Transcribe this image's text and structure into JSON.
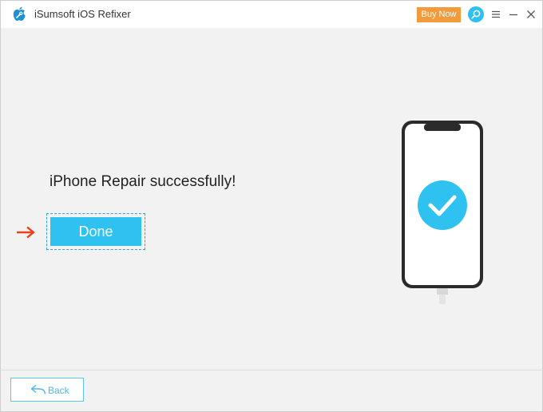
{
  "app": {
    "title": "iSumsoft iOS Refixer"
  },
  "header": {
    "buy_label": "Buy Now"
  },
  "main": {
    "message": "iPhone Repair successfully!",
    "done_label": "Done"
  },
  "footer": {
    "back_label": "Back"
  },
  "icons": {
    "logo": "apple-wrench-logo-icon",
    "search": "search-icon",
    "menu": "menu-icon",
    "minimize": "minimize-icon",
    "close": "close-icon",
    "arrow": "arrow-right-icon",
    "check": "checkmark-icon",
    "back": "back-arrow-icon"
  },
  "colors": {
    "accent": "#2fc2f1",
    "buy": "#f39a3b",
    "arrow": "#e8411f",
    "background": "#f2f2f2"
  }
}
